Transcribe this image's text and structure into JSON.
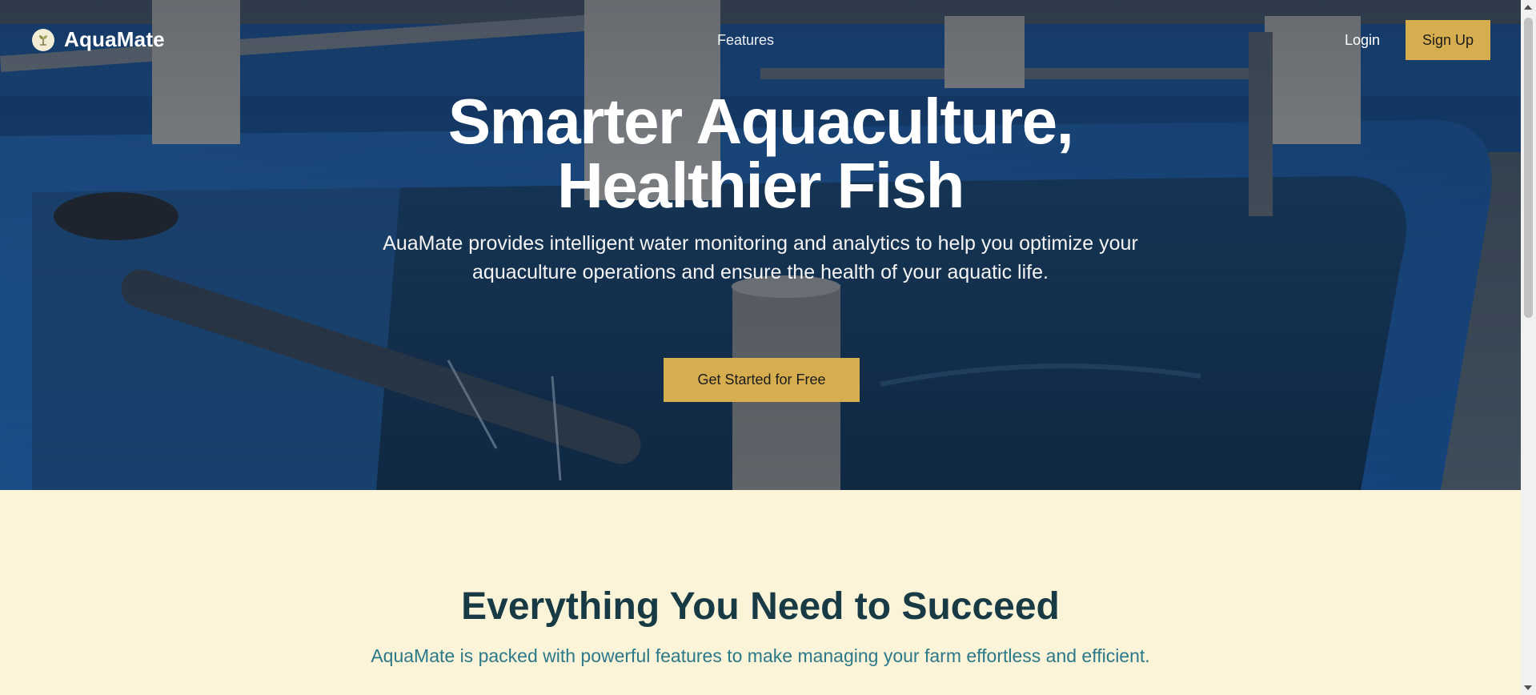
{
  "nav": {
    "brand": "AquaMate",
    "features_link": "Features",
    "login": "Login",
    "signup": "Sign Up"
  },
  "hero": {
    "title_line1": "Smarter Aquaculture,",
    "title_line2": "Healthier Fish",
    "subtitle": "AuaMate provides intelligent water monitoring and analytics to help you optimize your aquaculture operations and ensure the health of your aquatic life.",
    "cta": "Get Started for Free"
  },
  "features": {
    "title": "Everything You Need to Succeed",
    "subtitle": "AquaMate is packed with powerful features to make managing your farm effortless and efficient."
  },
  "icons": {
    "logo": "leaf-logo-icon",
    "scroll_up": "arrow-up-icon",
    "scroll_down": "arrow-down-icon"
  },
  "colors": {
    "accent": "#d6ae4f",
    "section_bg": "#fbf4d8",
    "heading": "#173a44",
    "subheading": "#2b7889",
    "tank_blue": "#1d5fb0"
  }
}
